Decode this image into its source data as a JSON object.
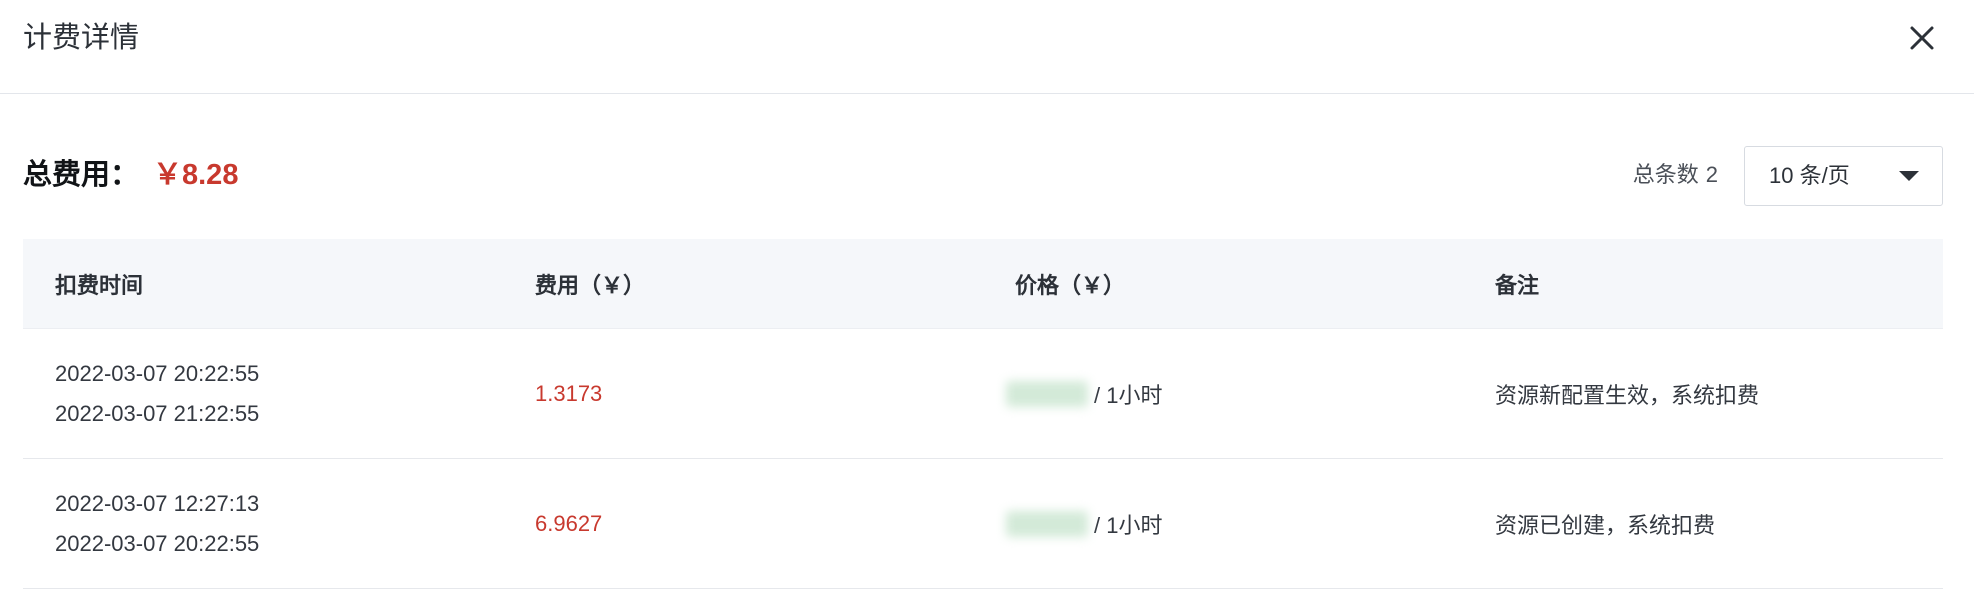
{
  "dialog": {
    "title": "计费详情",
    "close_icon": "close-icon"
  },
  "summary": {
    "total_label": "总费用：",
    "total_value": "￥8.28",
    "count_label": "总条数",
    "count_value": "2",
    "page_size": "10 条/页",
    "page_size_icon": "caret-down-icon"
  },
  "table": {
    "columns": [
      "扣费时间",
      "费用（￥）",
      "价格（￥）",
      "备注"
    ],
    "rows": [
      {
        "time_start": "2022-03-07 20:22:55",
        "time_end": "2022-03-07 21:22:55",
        "fee": "1.3173",
        "price_unit": "/ 1小时",
        "note": "资源新配置生效，系统扣费"
      },
      {
        "time_start": "2022-03-07 12:27:13",
        "time_end": "2022-03-07 20:22:55",
        "fee": "6.9627",
        "price_unit": "/ 1小时",
        "note": "资源已创建，系统扣费"
      }
    ]
  },
  "colors": {
    "accent": "#c8392e",
    "table_header_bg": "#f5f7fa"
  }
}
